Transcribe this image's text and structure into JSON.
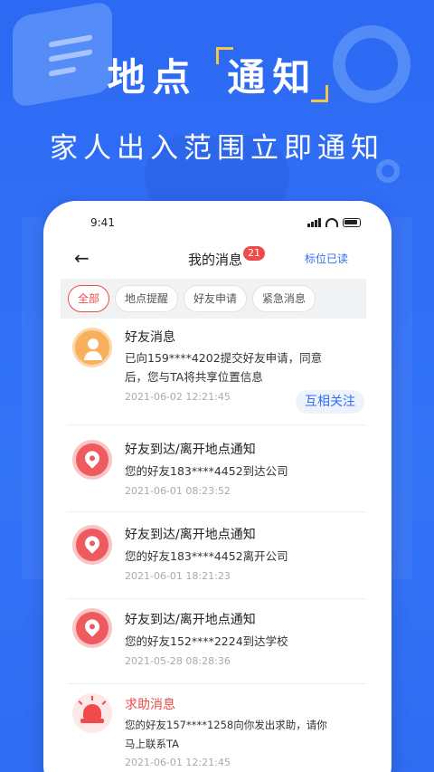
{
  "promo": {
    "title_part1": "地点",
    "title_part2": "通知",
    "subtitle": "家人出入范围立即通知"
  },
  "status_bar": {
    "time": "9:41"
  },
  "nav": {
    "title": "我的消息",
    "badge_count": "21",
    "mark_read": "标位已读"
  },
  "filters": [
    {
      "label": "全部",
      "active": true
    },
    {
      "label": "地点提醒",
      "active": false
    },
    {
      "label": "好友申请",
      "active": false
    },
    {
      "label": "紧急消息",
      "active": false
    }
  ],
  "messages": [
    {
      "type": "friend",
      "icon": "person-icon",
      "title": "好友消息",
      "text_line1": "已向159****4202提交好友申请，同意",
      "text_line2": "后，您与TA将共享位置信息",
      "time": "2021-06-02  12:21:45",
      "action": "互相关注"
    },
    {
      "type": "location",
      "icon": "location-pin-icon",
      "title": "好友到达/离开地点通知",
      "text_line1": "您的好友183****4452到达公司",
      "time": "2021-06-01  08:23:52"
    },
    {
      "type": "location",
      "icon": "location-pin-icon",
      "title": "好友到达/离开地点通知",
      "text_line1": "您的好友183****4452离开公司",
      "time": "2021-06-01  18:21:23"
    },
    {
      "type": "location",
      "icon": "location-pin-icon",
      "title": "好友到达/离开地点通知",
      "text_line1": "您的好友152****2224到达学校",
      "time": "2021-05-28  08:28:36"
    },
    {
      "type": "alert",
      "icon": "siren-icon",
      "title": "求助消息",
      "text_line1": "您的好友157****1258向你发出求助，请你",
      "text_line2": "马上联系TA",
      "time": "2021-06-01  12:21:45"
    }
  ],
  "colors": {
    "brand_blue": "#2f6ef5",
    "alert_red": "#f04a4a",
    "accent_yellow": "#f6c542"
  }
}
